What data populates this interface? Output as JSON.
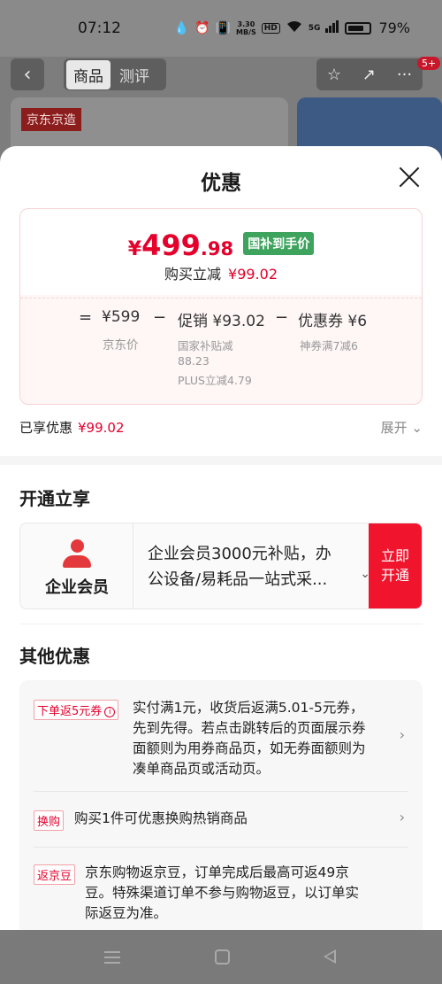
{
  "status_bar": {
    "time": "07:12",
    "net_speed_value": "3.30",
    "net_speed_unit": "MB/S",
    "hd": "HD",
    "signal": "5G",
    "battery_percent": 79,
    "battery_text": "79%"
  },
  "header": {
    "tab_product": "商品",
    "tab_review": "测评",
    "badge": "5+",
    "brand_tag": "京东京造"
  },
  "sheet": {
    "title": "优惠",
    "final_price": {
      "yen": "¥",
      "int": "499",
      "dec": ".98"
    },
    "price_tag": "国补到手价",
    "reduce_label": "购买立减",
    "reduce_value": "¥99.02",
    "breakdown": {
      "eq": "=",
      "jd_price": "¥599",
      "jd_price_label": "京东价",
      "minus1": "−",
      "promo": "促销 ¥93.02",
      "promo_sub1": "国家补贴减",
      "promo_sub1b": "88.23",
      "promo_sub2": "PLUS立减4.79",
      "minus2": "−",
      "coupon": "优惠券 ¥6",
      "coupon_sub": "神券满7减6"
    },
    "enjoyed_label": "已享优惠",
    "enjoyed_value": "¥99.02",
    "expand_label": "展开",
    "open_section_title": "开通立享",
    "member": {
      "label": "企业会员",
      "desc_line1": "企业会员3000元补贴，办",
      "desc_line2": "公设备/易耗品一站式采...",
      "btn_line1": "立即",
      "btn_line2": "开通"
    },
    "other_section_title": "其他优惠",
    "promos": [
      {
        "tag": "下单返5元券",
        "lines": [
          "实付满1元，收货后返满5.01-5元券，",
          "先到先得。若点击跳转后的页面展示券",
          "面额则为用券商品页，如无券面额则为",
          "凑单商品页或活动页。"
        ]
      },
      {
        "tag": "换购",
        "lines": [
          "购买1件可优惠换购热销商品"
        ]
      },
      {
        "tag": "返京豆",
        "lines": [
          "京东购物返京豆，订单完成后最高可返49京",
          "豆。特殊渠道订单不参与购物返豆，以订单实",
          "际返豆为准。"
        ]
      }
    ]
  }
}
